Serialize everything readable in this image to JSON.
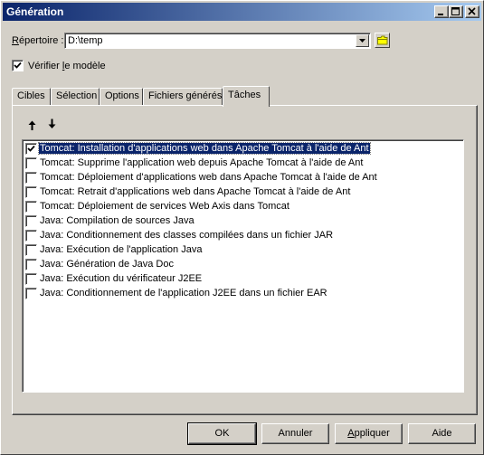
{
  "window": {
    "title": "Génération"
  },
  "directory": {
    "label_accel": "R",
    "label_rest": "épertoire :",
    "value": "D:\\temp"
  },
  "verify": {
    "label_pre": "Vérifier ",
    "label_accel": "l",
    "label_post": "e modèle",
    "checked": true
  },
  "tabs": [
    {
      "label": "Cibles"
    },
    {
      "label": "Sélection"
    },
    {
      "label": "Options"
    },
    {
      "label": "Fichiers générés"
    },
    {
      "label": "Tâches",
      "active": true
    }
  ],
  "tasks": [
    {
      "label": "Tomcat: Installation d'applications web dans Apache Tomcat à l'aide de Ant",
      "checked": true,
      "selected": true
    },
    {
      "label": "Tomcat: Supprime l'application web depuis Apache Tomcat à l'aide de Ant",
      "checked": false
    },
    {
      "label": "Tomcat: Déploiement d'applications web dans Apache Tomcat à l'aide de Ant",
      "checked": false
    },
    {
      "label": "Tomcat: Retrait d'applications web dans Apache Tomcat à l'aide de Ant",
      "checked": false
    },
    {
      "label": "Tomcat: Déploiement de services Web Axis dans Tomcat",
      "checked": false
    },
    {
      "label": "Java: Compilation de sources Java",
      "checked": false
    },
    {
      "label": "Java: Conditionnement des classes compilées dans un fichier JAR",
      "checked": false
    },
    {
      "label": "Java: Exécution de l'application Java",
      "checked": false
    },
    {
      "label": "Java: Génération de Java Doc",
      "checked": false
    },
    {
      "label": "Java: Exécution du vérificateur J2EE",
      "checked": false
    },
    {
      "label": "Java: Conditionnement de l'application J2EE dans un fichier EAR",
      "checked": false
    }
  ],
  "buttons": {
    "ok": "OK",
    "cancel": "Annuler",
    "apply_accel": "A",
    "apply_rest": "ppliquer",
    "help": "Aide"
  }
}
